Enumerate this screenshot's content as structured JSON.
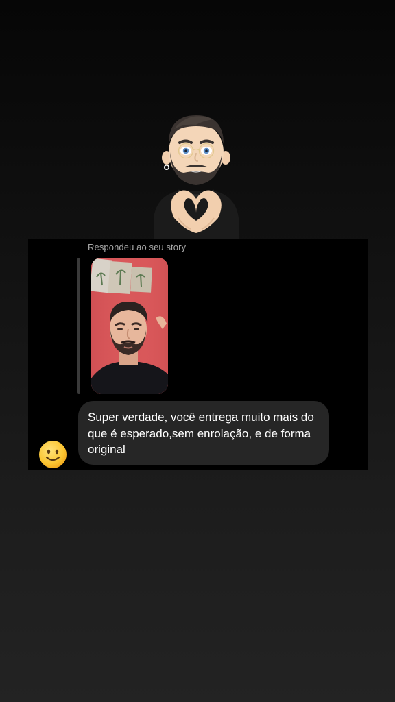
{
  "icons": {
    "sticker": "memoji-heart-hands-sticker",
    "avatar": "smiling-face-emoji"
  },
  "colors": {
    "background_top": "#060606",
    "background_bottom": "#232323",
    "card_background": "#000000",
    "bubble_background": "#262626",
    "reply_label": "#a8a8a8",
    "story_wall": "#d9575a"
  },
  "conversation": {
    "reply_label": "Respondeu ao seu story",
    "message_text": "Super verdade, você entrega muito mais do que é esperado,sem enrolação, e de forma original"
  }
}
